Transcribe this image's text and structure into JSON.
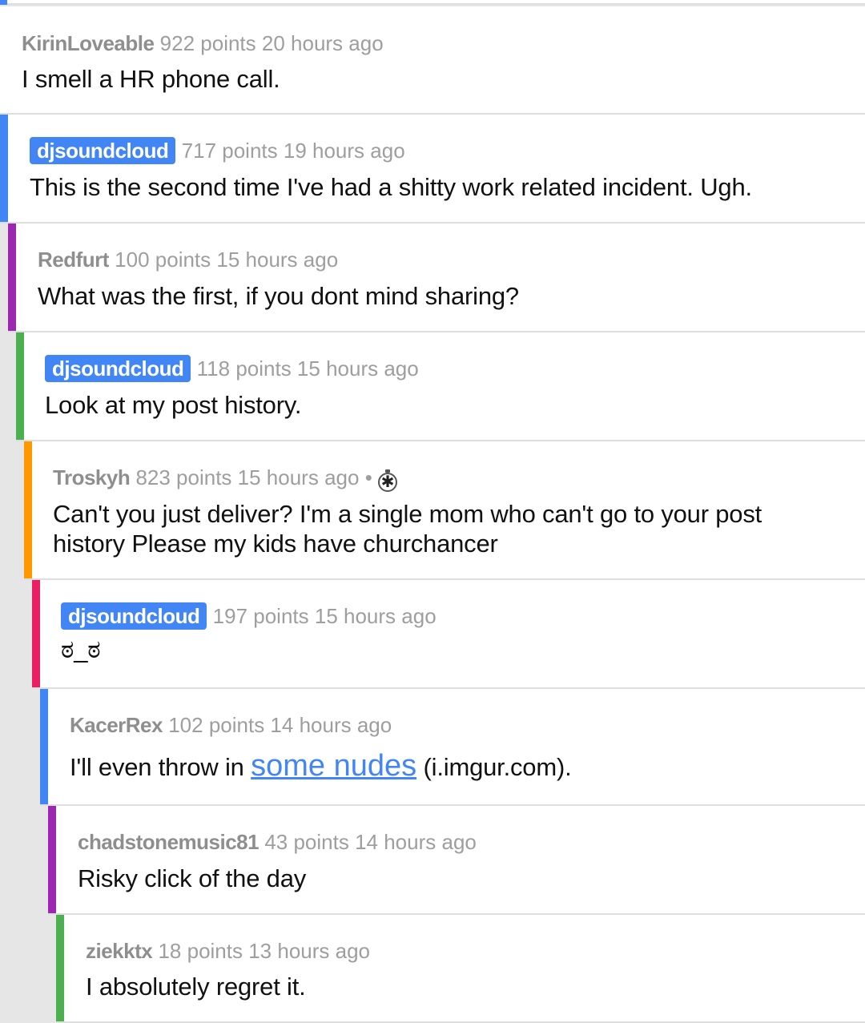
{
  "colors": {
    "op_badge": "#4285f4",
    "depth_1": "#4285f4",
    "depth_2": "#9c27b0",
    "depth_3": "#4caf50",
    "depth_4": "#ff9800",
    "depth_5": "#e91e63",
    "link": "#4285f4"
  },
  "comments": [
    {
      "author": "KirinLoveable",
      "stats": "922 points 20 hours ago",
      "body": "I smell a HR phone call."
    },
    {
      "author": "djsoundcloud",
      "is_op": true,
      "stats": "717 points 19 hours ago",
      "body": "This is the second time I've had a shitty work related incident. Ugh."
    },
    {
      "author": "Redfurt",
      "stats": "100 points 15 hours ago",
      "body": "What was the first, if you dont mind sharing?"
    },
    {
      "author": "djsoundcloud",
      "is_op": true,
      "stats": "118 points 15 hours ago",
      "body": "Look at my post history."
    },
    {
      "author": "Troskyh",
      "stats": "823 points 15 hours ago",
      "separator": "•",
      "gilded_icon": "gold-award-icon",
      "body_line1": "Can't you just deliver? I'm a single mom who can't go to your post",
      "body_line2": "history Please my kids have churchancer"
    },
    {
      "author": "djsoundcloud",
      "is_op": true,
      "stats": "197 points 15 hours ago",
      "body": "ಠ_ಠ"
    },
    {
      "author": "KacerRex",
      "stats": "102 points 14 hours ago",
      "body_prefix": "I'll even throw in ",
      "link_text": "some nudes",
      "body_suffix": " (i.imgur.com)."
    },
    {
      "author": "chadstonemusic81",
      "stats": "43 points 14 hours ago",
      "body": "Risky click of the day"
    },
    {
      "author": "ziekktx",
      "stats": "18 points 13 hours ago",
      "body": "I absolutely regret it."
    }
  ]
}
